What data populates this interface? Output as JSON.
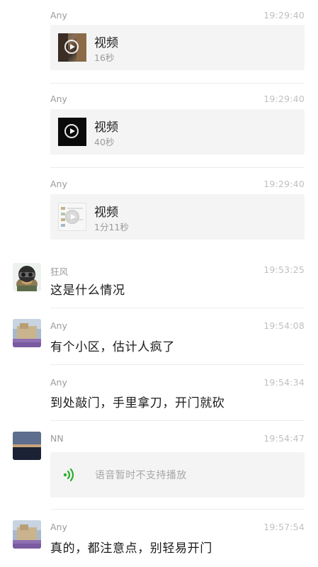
{
  "messages": [
    {
      "sender": "Any",
      "time": "19:29:40",
      "video": {
        "title": "视频",
        "duration": "16秒"
      }
    },
    {
      "sender": "Any",
      "time": "19:29:40",
      "video": {
        "title": "视频",
        "duration": "40秒"
      }
    },
    {
      "sender": "Any",
      "time": "19:29:40",
      "video": {
        "title": "视频",
        "duration": "1分11秒"
      }
    },
    {
      "sender": "狂风",
      "time": "19:53:25",
      "text": "这是什么情况"
    },
    {
      "sender": "Any",
      "time": "19:54:08",
      "text": "有个小区，估计人疯了"
    },
    {
      "sender": "Any",
      "time": "19:54:34",
      "text": "到处敲门，手里拿刀，开门就砍"
    },
    {
      "sender": "NN",
      "time": "19:54:47",
      "voice": "语音暂时不支持播放"
    },
    {
      "sender": "Any",
      "time": "19:57:54",
      "text": "真的，都注意点，别轻易开门"
    }
  ],
  "colors": {
    "voice_icon": "#2aae2a",
    "card_bg": "#f4f4f4"
  }
}
